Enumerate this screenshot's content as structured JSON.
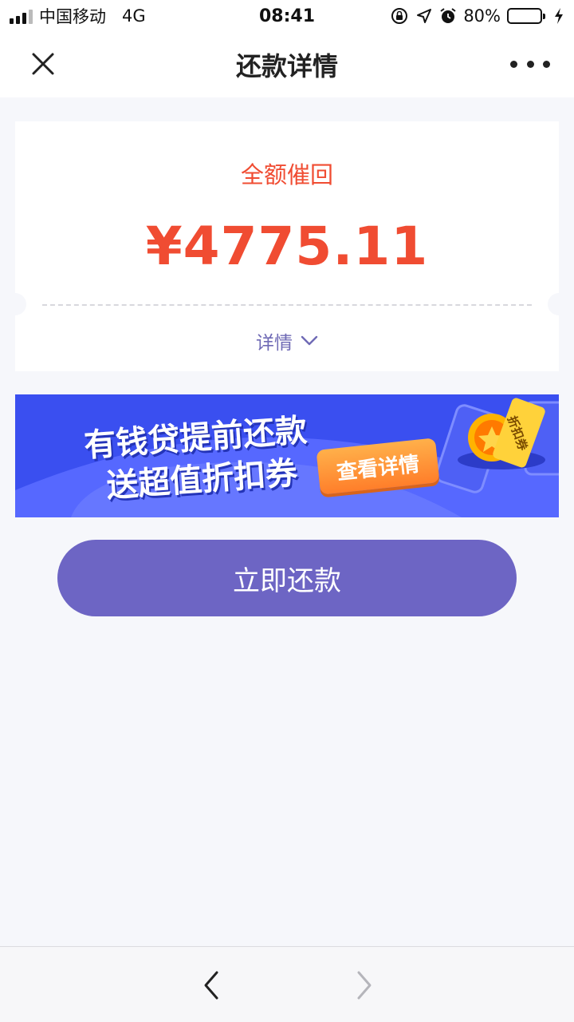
{
  "status_bar": {
    "carrier": "中国移动",
    "network": "4G",
    "time": "08:41",
    "battery_percent": "80%",
    "battery_level": 0.8,
    "icons": [
      "signal-icon",
      "orientation-lock-icon",
      "location-icon",
      "alarm-icon",
      "battery-icon",
      "charging-icon"
    ]
  },
  "nav": {
    "title": "还款详情",
    "close_icon": "close-icon",
    "more_icon": "more-icon"
  },
  "card": {
    "status": "全额催回",
    "amount": "¥4775.11",
    "detail_label": "详情",
    "detail_icon": "chevron-down-icon"
  },
  "banner": {
    "line1": "有钱贷提前还款",
    "line2": "送超值折扣券",
    "cta": "查看详情",
    "coupon_text": "折扣券"
  },
  "pay_button": {
    "label": "立即还款"
  },
  "bottom_bar": {
    "back_icon": "chevron-left-icon",
    "forward_icon": "chevron-right-icon"
  },
  "colors": {
    "accent": "#6d65c4",
    "amount": "#f04c32",
    "banner": "#3a4ff0",
    "cta": "#ff9a3a",
    "background": "#f6f7fb"
  }
}
